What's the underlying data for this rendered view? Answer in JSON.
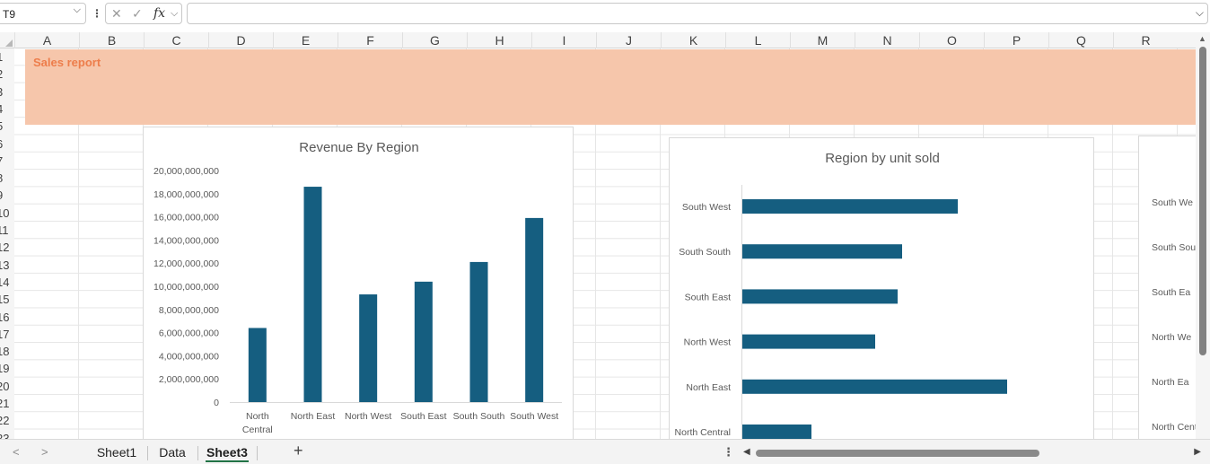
{
  "formula_bar": {
    "name_box": "T9",
    "fx_label": "fx",
    "cancel_glyph": "✕",
    "enter_glyph": "✓",
    "formula_value": ""
  },
  "columns": [
    "A",
    "B",
    "C",
    "D",
    "E",
    "F",
    "G",
    "H",
    "I",
    "J",
    "K",
    "L",
    "M",
    "N",
    "O",
    "P",
    "Q",
    "R"
  ],
  "rows": [
    "1",
    "2",
    "3",
    "4",
    "5",
    "6",
    "7",
    "8",
    "9",
    "10",
    "11",
    "12",
    "13",
    "14",
    "15",
    "16",
    "17",
    "18",
    "19",
    "20",
    "21",
    "22",
    "23"
  ],
  "banner": {
    "title": "Sales report",
    "color": "#f6c6ab",
    "title_color": "#ed7d4b"
  },
  "chart_data": [
    {
      "type": "bar",
      "title": "Revenue By Region",
      "categories": [
        "North Central",
        "North East",
        "North West",
        "South East",
        "South South",
        "South West"
      ],
      "values": [
        6400000000,
        18600000000,
        9300000000,
        10400000000,
        12100000000,
        15900000000
      ],
      "ylim": [
        0,
        20000000000
      ],
      "yticks": [
        "0",
        "2,000,000,000",
        "4,000,000,000",
        "6,000,000,000",
        "8,000,000,000",
        "10,000,000,000",
        "12,000,000,000",
        "14,000,000,000",
        "16,000,000,000",
        "18,000,000,000",
        "20,000,000,000"
      ],
      "xlabel": "",
      "ylabel": "",
      "color": "#155e80",
      "grid": false
    },
    {
      "type": "bar",
      "orientation": "horizontal",
      "title": "Region by unit sold",
      "categories": [
        "South West",
        "South South",
        "South East",
        "North West",
        "North East",
        "North Central"
      ],
      "values": [
        240,
        178,
        173,
        148,
        295,
        77
      ],
      "xlabel": "",
      "ylabel": "",
      "color": "#155e80",
      "grid": false
    },
    {
      "type": "bar",
      "orientation": "horizontal",
      "title": "",
      "categories": [
        "South We",
        "South Sou",
        "South Ea",
        "North We",
        "North Ea",
        "North Centr"
      ]
    }
  ],
  "sheet_tabs": [
    {
      "label": "Sheet1",
      "active": false
    },
    {
      "label": "Data",
      "active": false
    },
    {
      "label": "Sheet3",
      "active": true
    }
  ],
  "add_sheet_label": "+"
}
